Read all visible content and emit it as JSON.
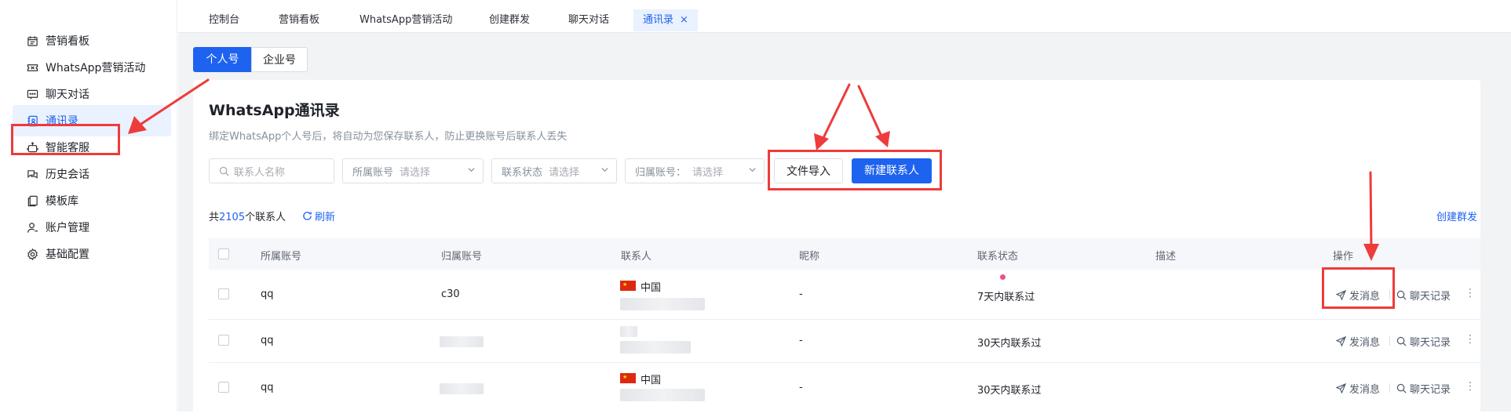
{
  "sidebar": {
    "items": [
      {
        "label": "营销看板",
        "icon": "calendar-icon"
      },
      {
        "label": "WhatsApp营销活动",
        "icon": "ticket-icon"
      },
      {
        "label": "聊天对话",
        "icon": "chat-icon"
      },
      {
        "label": "通讯录",
        "icon": "contacts-icon"
      },
      {
        "label": "智能客服",
        "icon": "robot-icon"
      },
      {
        "label": "历史会话",
        "icon": "history-chat-icon"
      },
      {
        "label": "模板库",
        "icon": "template-icon"
      },
      {
        "label": "账户管理",
        "icon": "user-icon"
      },
      {
        "label": "基础配置",
        "icon": "gear-icon"
      }
    ],
    "active_index": 3
  },
  "tabs": [
    {
      "label": "控制台"
    },
    {
      "label": "营销看板"
    },
    {
      "label": "WhatsApp营销活动"
    },
    {
      "label": "创建群发"
    },
    {
      "label": "聊天对话"
    },
    {
      "label": "通讯录",
      "close": "×",
      "active": true
    }
  ],
  "segment": {
    "personal": "个人号",
    "enterprise": "企业号"
  },
  "page": {
    "title": "WhatsApp通讯录",
    "subtitle": "绑定WhatsApp个人号后，将自动为您保存联系人，防止更换账号后联系人丢失"
  },
  "filters": {
    "contact_name_placeholder": "联系人名称",
    "account_label": "所属账号",
    "account_placeholder": "请选择",
    "status_label": "联系状态",
    "status_placeholder": "请选择",
    "owner_label": "归属账号：",
    "owner_placeholder": "请选择"
  },
  "buttons": {
    "import": "文件导入",
    "new_contact": "新建联系人"
  },
  "summary": {
    "prefix": "共",
    "count": "2105",
    "suffix": "个联系人",
    "refresh": "刷新",
    "create_group": "创建群发"
  },
  "table": {
    "columns": [
      "所属账号",
      "归属账号",
      "联系人",
      "昵称",
      "联系状态",
      "描述",
      "操作"
    ],
    "rows": [
      {
        "account": "qq",
        "owner": "c30",
        "country": "中国",
        "nickname": "-",
        "status": "7天内联系过",
        "description": ""
      },
      {
        "account": "qq",
        "owner": "",
        "country": "",
        "nickname": "-",
        "status": "30天内联系过",
        "description": ""
      },
      {
        "account": "qq",
        "owner": "",
        "country": "中国",
        "nickname": "-",
        "status": "30天内联系过",
        "description": ""
      }
    ],
    "actions": {
      "send": "发消息",
      "history": "聊天记录",
      "more": "⋮"
    }
  },
  "colors": {
    "primary": "#1e62f0",
    "annotation": "#ee3b3b"
  }
}
